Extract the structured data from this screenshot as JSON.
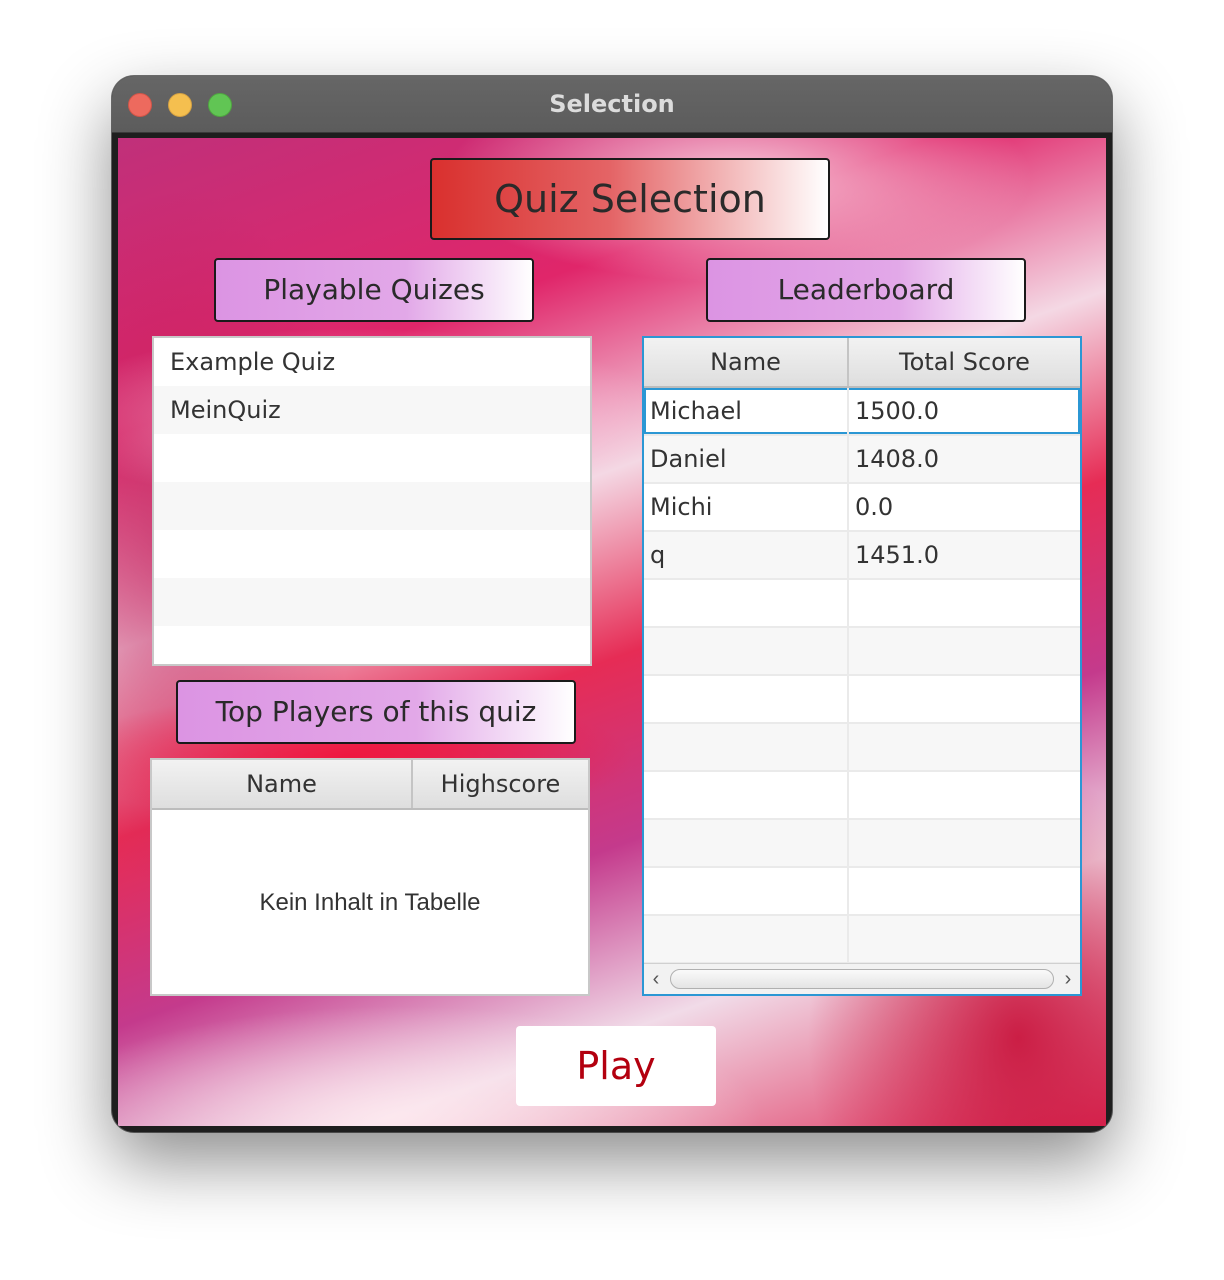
{
  "window": {
    "title": "Selection"
  },
  "headers": {
    "main": "Quiz Selection",
    "playable": "Playable Quizes",
    "leaderboard": "Leaderboard",
    "top_players": "Top Players of this quiz"
  },
  "quiz_list": {
    "items": [
      "Example Quiz",
      "MeinQuiz"
    ]
  },
  "top_players_table": {
    "columns": [
      "Name",
      "Highscore"
    ],
    "placeholder": "Kein Inhalt in Tabelle"
  },
  "leaderboard_table": {
    "columns": [
      "Name",
      "Total Score"
    ],
    "rows": [
      [
        "Michael",
        "1500.0"
      ],
      [
        "Daniel",
        "1408.0"
      ],
      [
        "Michi",
        "0.0"
      ],
      [
        "q",
        "1451.0"
      ]
    ],
    "selected_row": 0
  },
  "actions": {
    "play_label": "Play"
  },
  "colors": {
    "title_header_red": "#d9302e",
    "sub_header_purple": "#dc94e3",
    "play_text": "#b3000f",
    "selection_blue": "#2b97d4"
  }
}
